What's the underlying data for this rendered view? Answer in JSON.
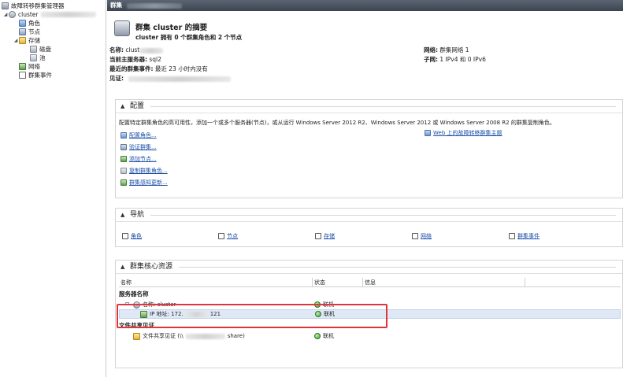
{
  "tree": {
    "root_label": "故障转移群集管理器",
    "cluster_label": "cluster",
    "items": [
      {
        "label": "角色",
        "icon": "roles-icon"
      },
      {
        "label": "节点",
        "icon": "nodes-icon"
      },
      {
        "label": "存储",
        "icon": "storage-icon"
      },
      {
        "label": "磁盘",
        "icon": "disk-icon"
      },
      {
        "label": "池",
        "icon": "pool-icon"
      },
      {
        "label": "网络",
        "icon": "network-icon"
      },
      {
        "label": "群集事件",
        "icon": "cluster-events-icon"
      }
    ]
  },
  "titlebar": {
    "title": "群集"
  },
  "summary": {
    "title": "群集 cluster 的摘要",
    "subtitle": "cluster 拥有 0 个群集角色和 2 个节点",
    "name_label": "名称:",
    "name_value": "clust",
    "host_label": "当前主服务器:",
    "host_value": "sql2",
    "event_label": "最近的群集事件:",
    "event_value": "最近 23 小时内没有",
    "witness_label": "见证:",
    "network_label": "网络:",
    "network_value": "群集网络 1",
    "subnet_label": "子网:",
    "subnet_value": "1 IPv4 和 0 IPv6"
  },
  "config": {
    "header": "配置",
    "description": "配置特定群集角色的高可用性，添加一个或多个服务器(节点)，或从运行 Windows Server 2012 R2、Windows Server 2012 或 Windows Server 2008 R2 的群集复制角色。",
    "actions": [
      "配置角色...",
      "验证群集...",
      "添加节点...",
      "复制群集角色...",
      "群集感知更新..."
    ],
    "web_link": "Web 上的故障转移群集主题"
  },
  "nav": {
    "header": "导航",
    "links": [
      "角色",
      "节点",
      "存储",
      "网络",
      "群集事件"
    ]
  },
  "core": {
    "header": "群集核心资源",
    "columns": {
      "name": "名称",
      "status": "状态",
      "info": "信息"
    },
    "group_server": "服务器名称",
    "row_name": "名称: cluster",
    "row_ip": "IP 地址: 172.",
    "row_ip_suffix": "121",
    "group_fileshare": "文件共享见证",
    "row_fileshare": "文件共享见证 (\\\\",
    "row_fileshare_suffix": "share)",
    "status_online": "联机"
  },
  "colors": {
    "highlight": "#e0353d",
    "link": "#1a4ea8",
    "online": "#3b9b25"
  }
}
